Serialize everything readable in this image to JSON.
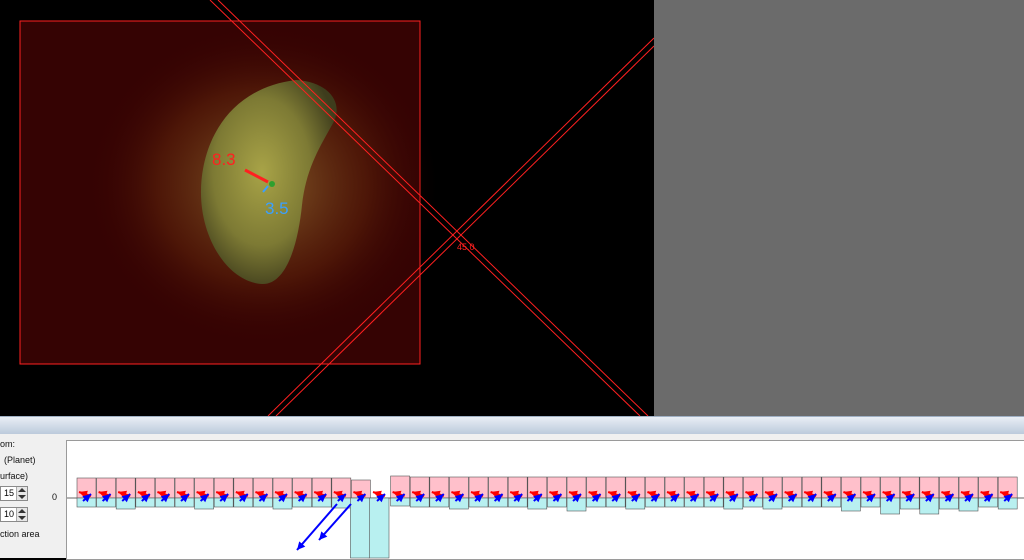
{
  "viewport": {
    "angle_label": "45.0",
    "measure_red": "8.3",
    "measure_blue": "3.5"
  },
  "side_panel": {
    "label_1": "om:",
    "label_2": "(Planet)",
    "label_3": "urface)",
    "spin_1_value": "15",
    "spin_2_value": "10",
    "label_4": "ction area"
  },
  "graph": {
    "zero_label": "0",
    "bar_count": 48,
    "special_bar_index": 14,
    "colors": {
      "positive_bar": "#ffc0cb",
      "negative_bar": "#b8f0f0",
      "red_arrow": "#ff0000",
      "blue_arrow": "#0000ff"
    }
  }
}
